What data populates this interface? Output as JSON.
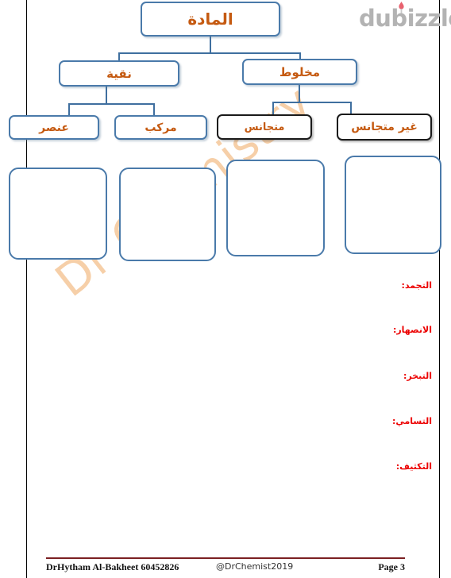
{
  "page": {
    "language": "ar",
    "background_color": "#ffffff",
    "rule_color": "#000000"
  },
  "watermarks": {
    "brand": {
      "text": "dubizzle",
      "color": "#b3b3b3",
      "flame_color": "#e8626f"
    },
    "center": {
      "text": "Dr Chemistry",
      "color": "#f6cfa8",
      "rotation": "-38deg"
    }
  },
  "flowchart": {
    "accent_border_color": "#4a7aaa",
    "alt_border_color": "#1a1a1a",
    "text_color": "#c55a11",
    "connector_color": "#3f6f9f",
    "nodes": [
      {
        "id": "matter",
        "label": "المادة",
        "level": 0,
        "border": "blue"
      },
      {
        "id": "pure",
        "label": "نقية",
        "level": 1,
        "border": "blue"
      },
      {
        "id": "mixture",
        "label": "مخلوط",
        "level": 1,
        "border": "blue"
      },
      {
        "id": "element",
        "label": "عنصر",
        "level": 2,
        "border": "blue"
      },
      {
        "id": "compound",
        "label": "مركب",
        "level": 2,
        "border": "blue"
      },
      {
        "id": "homogeneous",
        "label": "متجانس",
        "level": 2,
        "border": "black"
      },
      {
        "id": "heterogeneous",
        "label": "غير متجانس",
        "level": 2,
        "border": "black"
      }
    ],
    "answer_boxes": [
      {
        "id": "abox-1",
        "value": ""
      },
      {
        "id": "abox-2",
        "value": ""
      },
      {
        "id": "abox-3",
        "value": ""
      },
      {
        "id": "abox-4",
        "value": ""
      }
    ]
  },
  "terms": {
    "color": "#ec0000",
    "items": [
      {
        "label": "التجمد:"
      },
      {
        "label": "الانصهار:"
      },
      {
        "label": "التبخر:"
      },
      {
        "label": "التسامي:"
      },
      {
        "label": "التكثيف:"
      }
    ]
  },
  "footer": {
    "rule_color": "#7b1f22",
    "author": "DrHytham Al-Bakheet 60452826",
    "handle": "@DrChemist2019",
    "page_number": "Page 3"
  }
}
